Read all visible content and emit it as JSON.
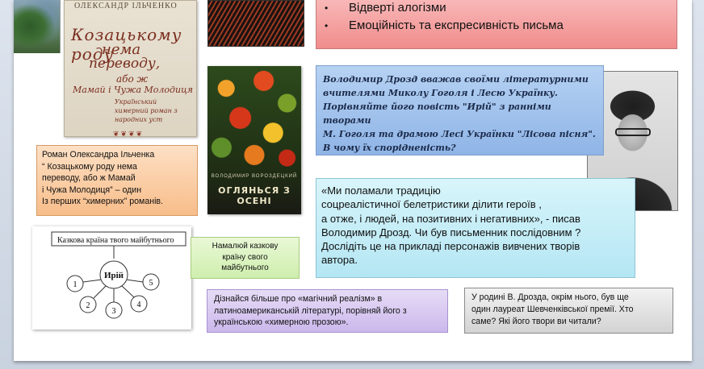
{
  "bullets": [
    "Відверті алогізми",
    "Емоційність та експресивність письма"
  ],
  "book1": {
    "author": "ОЛЕКСАНДР ІЛЬЧЕНКО",
    "title_lines": [
      "Козацькому роду",
      "нема",
      "переводу,",
      "або ж",
      "Мамай і Чужа Молодиця"
    ],
    "subtitle": "Український химерний роман з народних уст"
  },
  "book2": {
    "author": "ВОЛОДИМИР ВОРОЗДЕЦКИЙ",
    "title": "ОГЛЯНЬСЯ З ОСЕНІ"
  },
  "blue_box": {
    "lines": [
      "Володимир Дрозд вважав своїми літературними",
      "вчителями Миколу Гоголя і Лесю Українку.",
      "Порівняйте його повість \"Ирій\" з ранніми творами",
      "М. Гоголя та драмою Лесі Українки \"Лісова пісня\".",
      "В чому їх спорідненість?"
    ]
  },
  "cyan_box": {
    "lines": [
      "«Ми поламали традицію",
      "соцреалістичної белетристики ділити героїв ,",
      " а отже, і людей, на позитивних і негативних», - писав",
      "Володимир Дрозд. Чи був письменник послідовним ?",
      "Дослідіть це на прикладі персонажів вивчених творів",
      "автора."
    ]
  },
  "orange_box": {
    "lines": [
      "Роман Олександра  Ільченка",
      "“ Козацькому роду нема",
      "переводу, або ж Мамай",
      "і Чужа Молодиця” – один",
      "Із перших “химерних” романів."
    ]
  },
  "green_box": {
    "lines": [
      "Намалюй казкову",
      "країну свого",
      "майбутнього"
    ]
  },
  "purple_box": {
    "lines": [
      "Дізнайся більше про «магічний реалізм» в",
      "латиноамериканській літературі, порівняй його з",
      "українською «химерною прозою»."
    ]
  },
  "gray_box": {
    "lines": [
      "У родині В. Дрозда, окрім нього, був   ще",
      "один лауреат Шевченківської премії. Хто",
      "саме?  Які  його твори ви читали?"
    ]
  },
  "diagram": {
    "title": "Казкова країна твого майбутнього",
    "center": "Ирій",
    "nodes": [
      "1",
      "2",
      "3",
      "4",
      "5"
    ]
  },
  "colors": {
    "red_box": "#f08c8c",
    "blue_box": "#8fb4e6",
    "cyan_box": "#b4e6f3",
    "orange_box": "#f8bd8a",
    "green_box": "#cfeeae",
    "purple_box": "#cbb8ec",
    "gray_box": "#d3d3d3"
  }
}
